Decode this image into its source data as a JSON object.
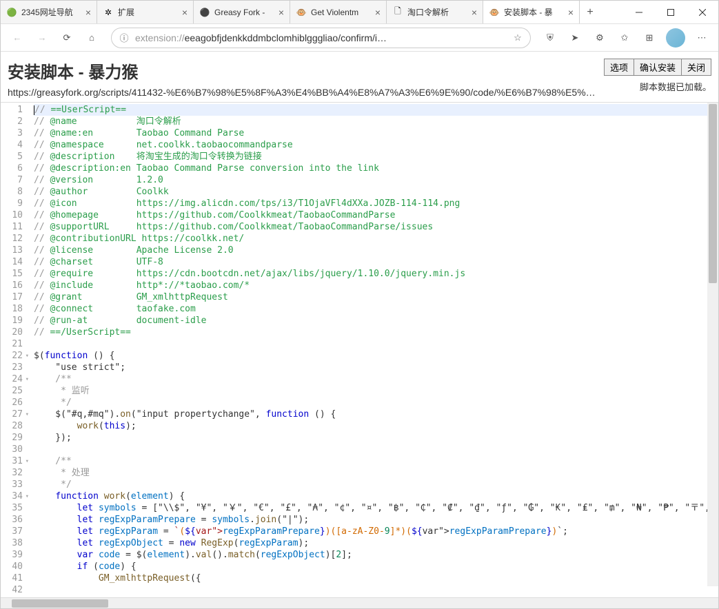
{
  "window": {
    "tabs": [
      {
        "icon": "2345",
        "title": "2345网址导航"
      },
      {
        "icon": "ext",
        "title": "扩展"
      },
      {
        "icon": "gf",
        "title": "Greasy Fork -"
      },
      {
        "icon": "vm",
        "title": "Get Violentm"
      },
      {
        "icon": "doc",
        "title": "淘口令解析"
      },
      {
        "icon": "vm",
        "title": "安装脚本 - 暴"
      }
    ]
  },
  "addressbar": {
    "scheme": "extension://",
    "path": "eeagobfjdenkkddmbclomhiblgggliao/confirm/i…"
  },
  "ext": {
    "title": "安装脚本 - 暴力猴",
    "url": "https://greasyfork.org/scripts/411432-%E6%B7%98%E5%8F%A3%E4%BB%A4%E8%A7%A3%E6%9E%90/code/%E6%B7%98%E5%8F…",
    "status": "脚本数据已加载。",
    "buttons": {
      "options": "选项",
      "confirm": "确认安装",
      "close": "关闭"
    }
  },
  "code": {
    "lines": [
      "// ==UserScript==",
      "// @name           淘口令解析",
      "// @name:en        Taobao Command Parse",
      "// @namespace      net.coolkk.taobaocommandparse",
      "// @description    将淘宝生成的淘口令转换为链接",
      "// @description:en Taobao Command Parse conversion into the link",
      "// @version        1.2.0",
      "// @author         Coolkk",
      "// @icon           https://img.alicdn.com/tps/i3/T1OjaVFl4dXXa.JOZB-114-114.png",
      "// @homepage       https://github.com/Coolkkmeat/TaobaoCommandParse",
      "// @supportURL     https://github.com/Coolkkmeat/TaobaoCommandParse/issues",
      "// @contributionURL https://coolkk.net/",
      "// @license        Apache License 2.0",
      "// @charset        UTF-8",
      "// @require        https://cdn.bootcdn.net/ajax/libs/jquery/1.10.0/jquery.min.js",
      "// @include        http*://*taobao.com/*",
      "// @grant          GM_xmlhttpRequest",
      "// @connect        taofake.com",
      "// @run-at         document-idle",
      "// ==/UserScript==",
      "",
      "$(function () {",
      "    \"use strict\";",
      "    /**",
      "     * 监听",
      "     */",
      "    $(\"#q,#mq\").on(\"input propertychange\", function () {",
      "        work(this);",
      "    });",
      "",
      "    /**",
      "     * 处理",
      "     */",
      "    function work(element) {",
      "        let symbols = [\"\\\\$\", \"¥\", \"￥\", \"€\", \"£\", \"₳\", \"¢\", \"¤\", \"฿\", \"₵\", \"₡\", \"₫\", \"ƒ\", \"₲\", \"₭\", \"₤\", \"₥\", \"₦\", \"₱\", \"〒\", \"₮\", \"₩",
      "        let regExpParamPrepare = symbols.join(\"|\");",
      "        let regExpParam = `(${regExpParamPrepare})([a-zA-Z0-9]*)(${regExpParamPrepare})`;",
      "        let regExpObject = new RegExp(regExpParam);",
      "        var code = $(element).val().match(regExpObject)[2];",
      "        if (code) {",
      "            GM_xmlhttpRequest({",
      ""
    ]
  }
}
